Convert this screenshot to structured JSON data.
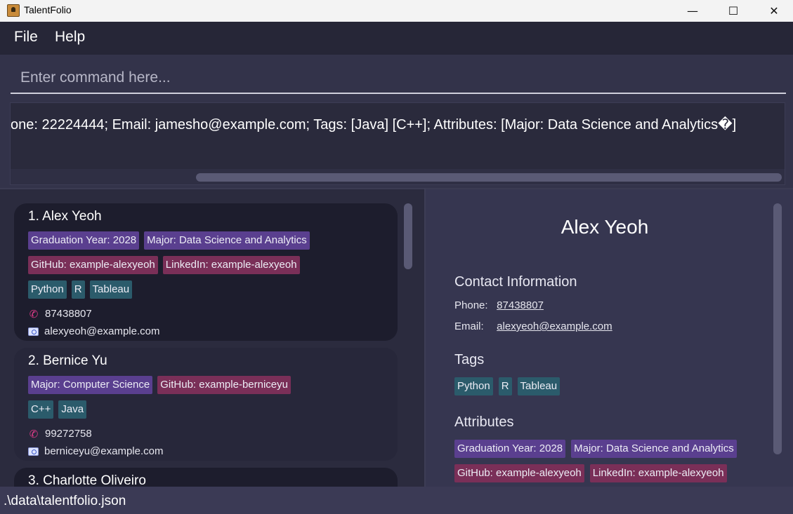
{
  "window": {
    "title": "TalentFolio",
    "minimize_glyph": "—",
    "maximize_glyph": "☐",
    "close_glyph": "✕"
  },
  "menu": {
    "file": "File",
    "help": "Help"
  },
  "command": {
    "placeholder": "Enter command here..."
  },
  "result": {
    "text": "one: 22224444; Email: jamesho@example.com; Tags: [Java] [C++]; Attributes: [Major: Data Science and Analytics�]"
  },
  "persons": [
    {
      "name": "1. Alex Yeoh",
      "attr_rows": [
        [
          "Graduation Year: 2028",
          "Major: Data Science and Analytics"
        ],
        [
          "GitHub: example-alexyeoh",
          "LinkedIn: example-alexyeoh"
        ]
      ],
      "tags": [
        "Python",
        "R",
        "Tableau"
      ],
      "phone": "87438807",
      "email": "alexyeoh@example.com"
    },
    {
      "name": "2. Bernice Yu",
      "attr_rows": [
        [
          "Major: Computer Science",
          "GitHub: example-berniceyu"
        ]
      ],
      "tags": [
        "C++",
        "Java"
      ],
      "phone": "99272758",
      "email": "berniceyu@example.com"
    },
    {
      "name": "3. Charlotte Oliveiro"
    }
  ],
  "detail": {
    "name": "Alex Yeoh",
    "contact_heading": "Contact Information",
    "phone_label": "Phone:",
    "phone": "87438807",
    "email_label": "Email:",
    "email": "alexyeoh@example.com",
    "tags_heading": "Tags",
    "tags": [
      "Python",
      "R",
      "Tableau"
    ],
    "attributes_heading": "Attributes",
    "attributes": [
      "Graduation Year: 2028",
      "Major: Data Science and Analytics",
      "GitHub: example-alexyeoh",
      "LinkedIn: example-alexyeoh"
    ]
  },
  "status": {
    "path": ".\\data\\talentfolio.json"
  },
  "colors": {
    "chip_purple": "#5a3f8f",
    "chip_pink": "#7a2f58",
    "chip_teal": "#2b5b6b",
    "phone_icon": "#e03c8a"
  }
}
